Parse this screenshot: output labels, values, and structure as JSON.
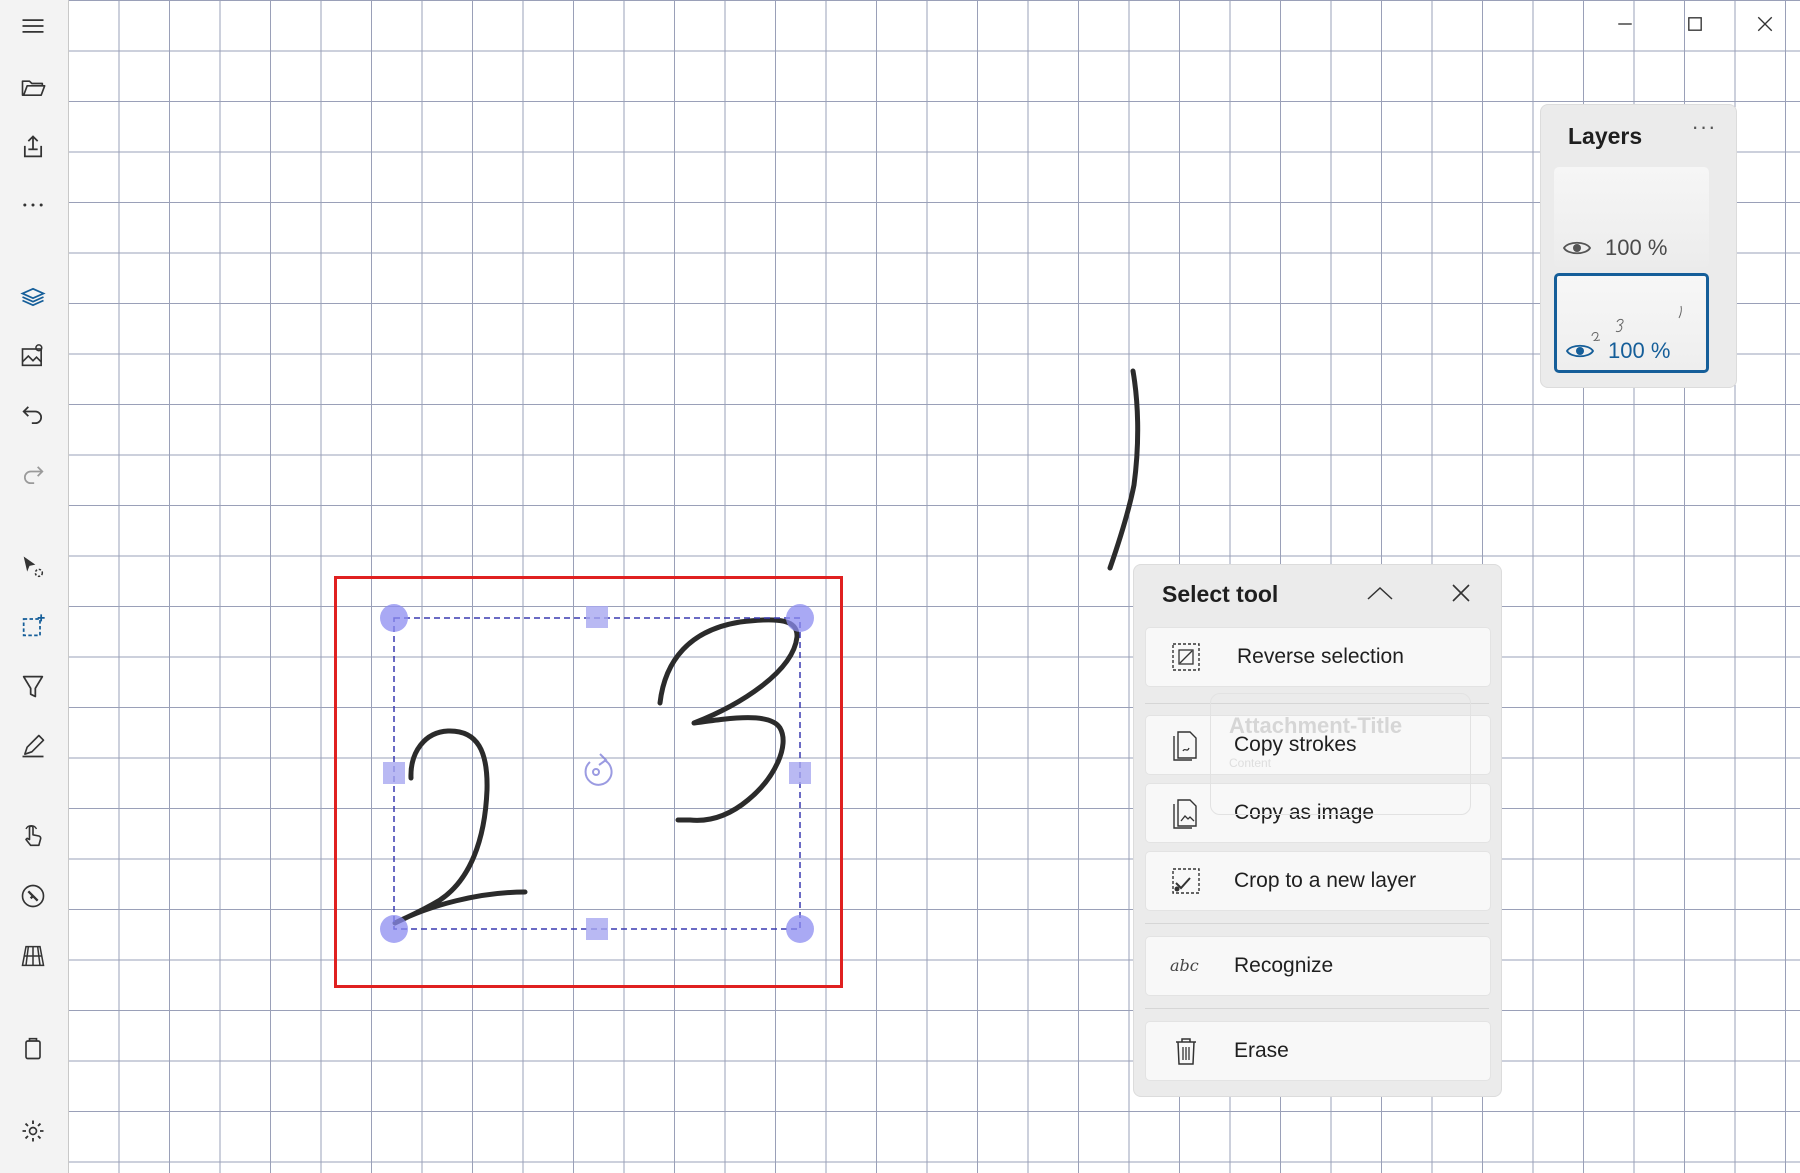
{
  "window": {
    "minimize_icon": "minimize-icon",
    "maximize_icon": "maximize-icon",
    "close_icon": "close-icon"
  },
  "toolbar": {
    "items": [
      {
        "name": "menu",
        "icon": "hamburger-icon"
      },
      {
        "name": "open",
        "icon": "folder-open-icon"
      },
      {
        "name": "export",
        "icon": "share-export-icon"
      },
      {
        "name": "more",
        "icon": "more-horizontal-icon"
      },
      {
        "name": "layers",
        "icon": "layers-icon"
      },
      {
        "name": "insert-image",
        "icon": "image-icon"
      },
      {
        "name": "undo",
        "icon": "undo-icon"
      },
      {
        "name": "redo",
        "icon": "redo-icon"
      },
      {
        "name": "select-pointer",
        "icon": "pointer-select-icon"
      },
      {
        "name": "rect-select",
        "icon": "rectangle-select-icon"
      },
      {
        "name": "highlighter",
        "icon": "highlighter-icon"
      },
      {
        "name": "pen",
        "icon": "pen-icon"
      },
      {
        "name": "touch",
        "icon": "touch-hand-icon"
      },
      {
        "name": "ruler",
        "icon": "ruler-compass-icon"
      },
      {
        "name": "grid",
        "icon": "grid-perspective-icon"
      },
      {
        "name": "clipboard",
        "icon": "clipboard-icon"
      },
      {
        "name": "settings",
        "icon": "gear-icon"
      }
    ]
  },
  "layers": {
    "title": "Layers",
    "more_label": "···",
    "items": [
      {
        "opacity": "100 %",
        "selected": false
      },
      {
        "opacity": "100 %",
        "selected": true
      }
    ]
  },
  "select_tool": {
    "title": "Select tool",
    "actions": [
      {
        "label": "Reverse selection",
        "icon": "reverse-selection-icon"
      },
      {
        "label": "Copy strokes",
        "icon": "copy-strokes-icon"
      },
      {
        "label": "Copy as image",
        "icon": "copy-image-icon"
      },
      {
        "label": "Crop to a new layer",
        "icon": "crop-layer-icon"
      },
      {
        "label": "Recognize",
        "icon": "recognize-abc-icon"
      },
      {
        "label": "Erase",
        "icon": "trash-icon"
      }
    ],
    "recognize_glyph": "abc"
  },
  "ghost_attachment": {
    "title": "Attachment-Title",
    "subtitle": "Content"
  },
  "colors": {
    "accent": "#155e99",
    "selection_red": "#e02020",
    "handle_blue": "#8c8cf0",
    "grid_line": "#9aa0b8",
    "panel_bg": "#ebebeb"
  }
}
